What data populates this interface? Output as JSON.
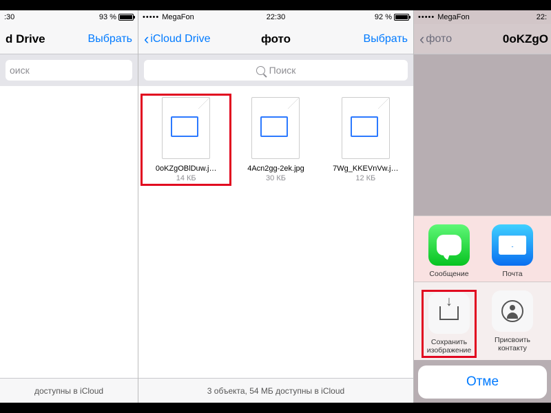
{
  "shot1": {
    "status": {
      "battery_pct": "93 %",
      "time_suffix": ":30"
    },
    "nav": {
      "title_suffix": "d Drive",
      "select": "Выбрать"
    },
    "search": {
      "placeholder_suffix": "оиск"
    },
    "footer_suffix": "доступны в iCloud"
  },
  "shot2": {
    "status": {
      "carrier": "MegaFon",
      "time": "22:30",
      "battery_pct": "92 %"
    },
    "nav": {
      "back": "iCloud Drive",
      "title": "фото",
      "select": "Выбрать"
    },
    "search": {
      "placeholder": "Поиск"
    },
    "files": [
      {
        "name": "0oKZgOBlDuw.j…",
        "size": "14 КБ"
      },
      {
        "name": "4Acn2gg-2ek.jpg",
        "size": "30 КБ"
      },
      {
        "name": "7Wg_KKEVnVw.j…",
        "size": "12 КБ"
      }
    ],
    "footer": "3 объекта, 54 МБ доступны в iCloud"
  },
  "shot3": {
    "status": {
      "carrier": "MegaFon",
      "time_prefix": "22:"
    },
    "nav": {
      "back": "фото",
      "title_prefix": "0oKZgO"
    },
    "share": {
      "row1": [
        {
          "id": "messages",
          "label": "Сообщение"
        },
        {
          "id": "mail",
          "label": "Почта"
        }
      ],
      "row2": [
        {
          "id": "save-image",
          "label": "Сохранить изображение"
        },
        {
          "id": "assign-contact",
          "label": "Присвоить контакту"
        }
      ],
      "cancel_prefix": "Отме"
    }
  }
}
